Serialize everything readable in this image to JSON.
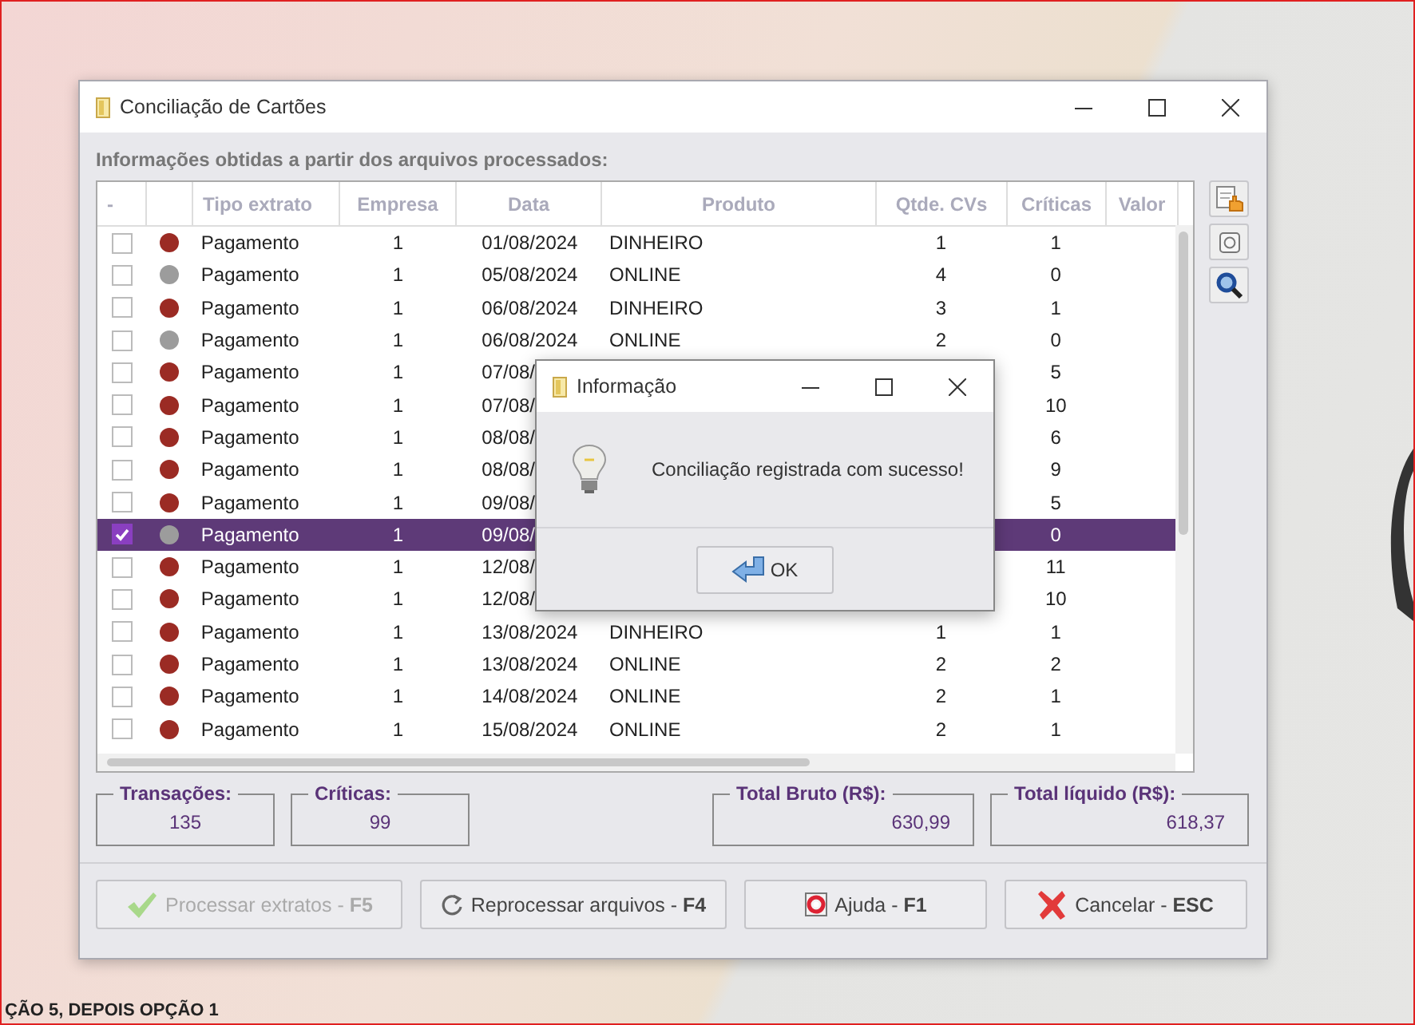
{
  "window": {
    "title": "Conciliação de Cartões"
  },
  "section_label": "Informações obtidas a partir dos arquivos processados:",
  "table": {
    "columns": [
      "-",
      "",
      "Tipo extrato",
      "Empresa",
      "Data",
      "Produto",
      "Qtde. CVs",
      "Críticas",
      "Valor"
    ],
    "rows": [
      {
        "checked": false,
        "selected": false,
        "color": "#9b2b24",
        "tipo": "Pagamento",
        "empresa": "1",
        "data": "01/08/2024",
        "produto": "DINHEIRO",
        "qtde": "1",
        "criticas": "1"
      },
      {
        "checked": false,
        "selected": false,
        "color": "#9c9c9c",
        "tipo": "Pagamento",
        "empresa": "1",
        "data": "05/08/2024",
        "produto": "ONLINE",
        "qtde": "4",
        "criticas": "0"
      },
      {
        "checked": false,
        "selected": false,
        "color": "#9b2b24",
        "tipo": "Pagamento",
        "empresa": "1",
        "data": "06/08/2024",
        "produto": "DINHEIRO",
        "qtde": "3",
        "criticas": "1"
      },
      {
        "checked": false,
        "selected": false,
        "color": "#9c9c9c",
        "tipo": "Pagamento",
        "empresa": "1",
        "data": "06/08/2024",
        "produto": "ONLINE",
        "qtde": "2",
        "criticas": "0"
      },
      {
        "checked": false,
        "selected": false,
        "color": "#9b2b24",
        "tipo": "Pagamento",
        "empresa": "1",
        "data": "07/08/",
        "criticas": "5"
      },
      {
        "checked": false,
        "selected": false,
        "color": "#9b2b24",
        "tipo": "Pagamento",
        "empresa": "1",
        "data": "07/08/",
        "criticas": "10"
      },
      {
        "checked": false,
        "selected": false,
        "color": "#9b2b24",
        "tipo": "Pagamento",
        "empresa": "1",
        "data": "08/08/",
        "criticas": "6"
      },
      {
        "checked": false,
        "selected": false,
        "color": "#9b2b24",
        "tipo": "Pagamento",
        "empresa": "1",
        "data": "08/08/",
        "criticas": "9"
      },
      {
        "checked": false,
        "selected": false,
        "color": "#9b2b24",
        "tipo": "Pagamento",
        "empresa": "1",
        "data": "09/08/",
        "criticas": "5"
      },
      {
        "checked": true,
        "selected": true,
        "color": "#9c9c9c",
        "tipo": "Pagamento",
        "empresa": "1",
        "data": "09/08/",
        "criticas": "0"
      },
      {
        "checked": false,
        "selected": false,
        "color": "#9b2b24",
        "tipo": "Pagamento",
        "empresa": "1",
        "data": "12/08/",
        "criticas": "11"
      },
      {
        "checked": false,
        "selected": false,
        "color": "#9b2b24",
        "tipo": "Pagamento",
        "empresa": "1",
        "data": "12/08/",
        "criticas": "10"
      },
      {
        "checked": false,
        "selected": false,
        "color": "#9b2b24",
        "tipo": "Pagamento",
        "empresa": "1",
        "data": "13/08/2024",
        "produto": "DINHEIRO",
        "qtde": "1",
        "criticas": "1"
      },
      {
        "checked": false,
        "selected": false,
        "color": "#9b2b24",
        "tipo": "Pagamento",
        "empresa": "1",
        "data": "13/08/2024",
        "produto": "ONLINE",
        "qtde": "2",
        "criticas": "2"
      },
      {
        "checked": false,
        "selected": false,
        "color": "#9b2b24",
        "tipo": "Pagamento",
        "empresa": "1",
        "data": "14/08/2024",
        "produto": "ONLINE",
        "qtde": "2",
        "criticas": "1"
      },
      {
        "checked": false,
        "selected": false,
        "color": "#9b2b24",
        "tipo": "Pagamento",
        "empresa": "1",
        "data": "15/08/2024",
        "produto": "ONLINE",
        "qtde": "2",
        "criticas": "1"
      }
    ]
  },
  "summary": [
    {
      "label": "Transações:",
      "value": "135"
    },
    {
      "label": "Críticas:",
      "value": "99"
    },
    {
      "label": "Total Bruto (R$):",
      "value": "630,99"
    },
    {
      "label": "Total líquido (R$):",
      "value": "618,37"
    }
  ],
  "buttons": [
    {
      "kind": "process",
      "label": "Processar extratos - ",
      "key": "F5",
      "disabled": true
    },
    {
      "kind": "reprocess",
      "label": "Reprocessar arquivos - ",
      "key": "F4",
      "disabled": false
    },
    {
      "kind": "help",
      "label": "Ajuda - ",
      "key": "F1",
      "disabled": false
    },
    {
      "kind": "cancel",
      "label": "Cancelar - ",
      "key": "ESC",
      "disabled": false
    }
  ],
  "dialog": {
    "title": "Informação",
    "message": "Conciliação registrada com sucesso!",
    "button": "OK"
  },
  "background_text": "ÇÃO 5, DEPOIS OPÇÃO 1"
}
